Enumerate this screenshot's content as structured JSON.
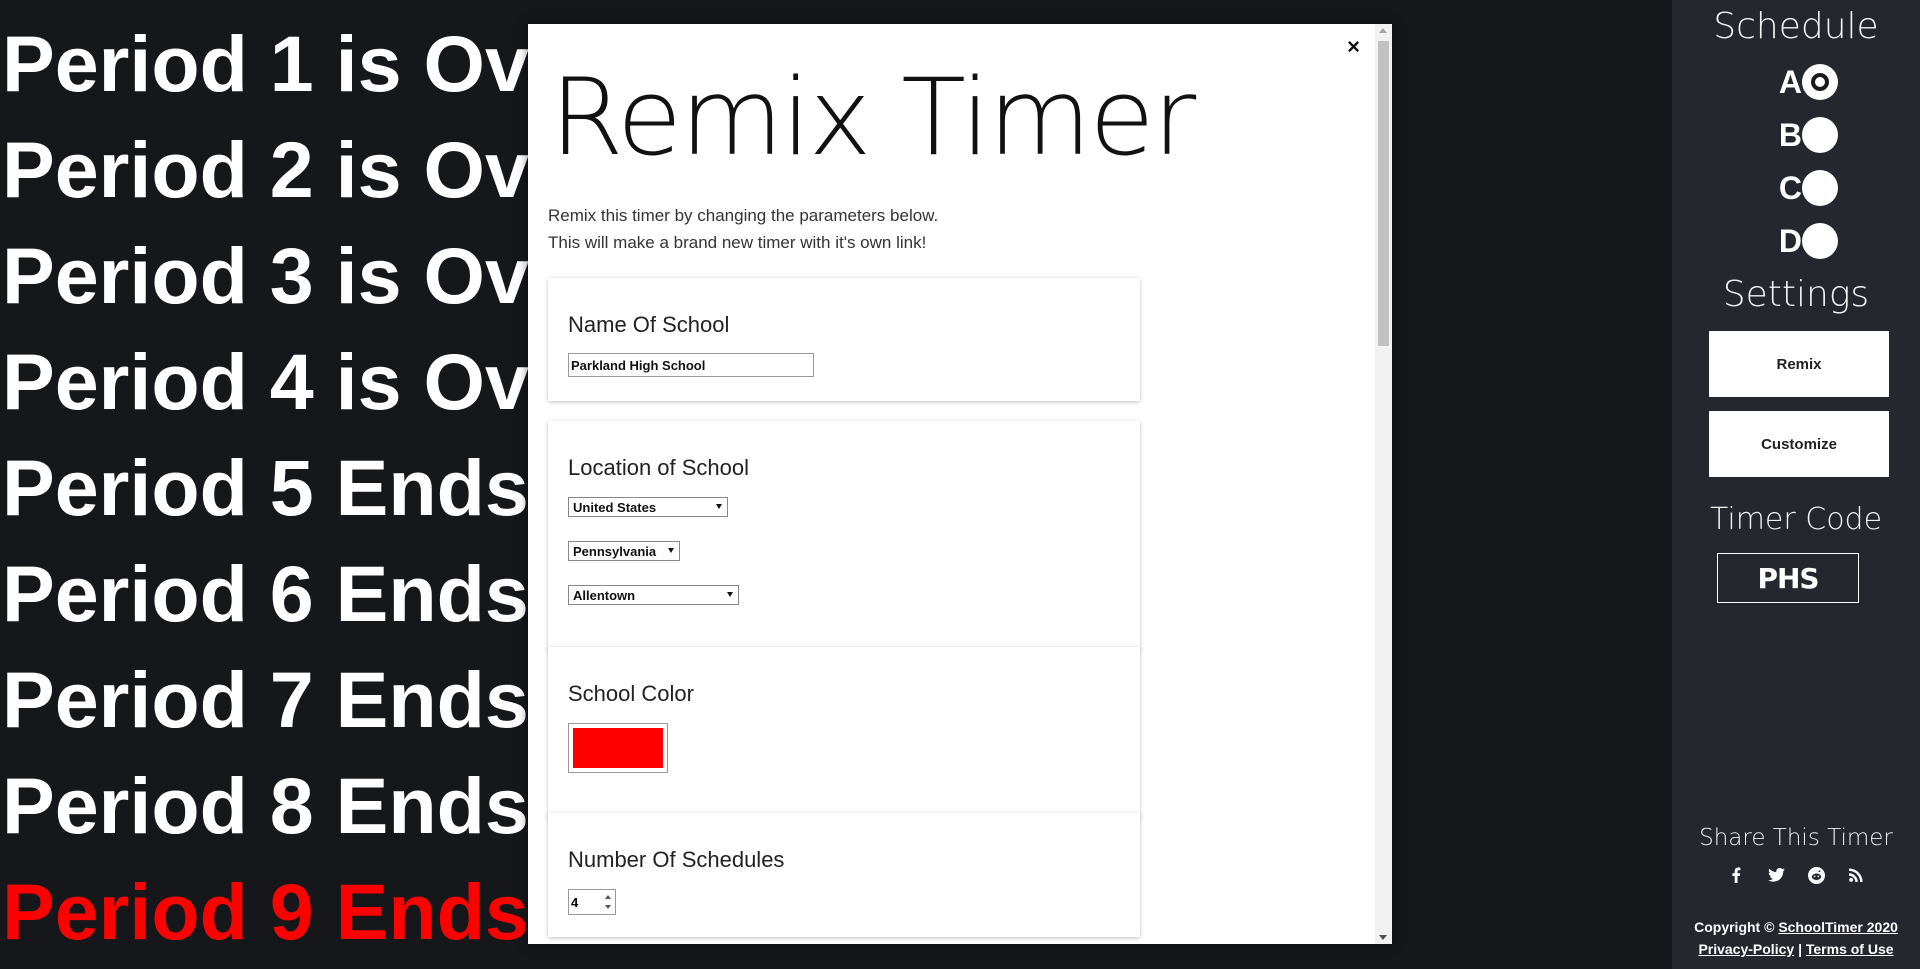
{
  "periods": [
    {
      "label": "Period 1 is Ov",
      "active": false
    },
    {
      "label": "Period 2 is Ov",
      "active": false
    },
    {
      "label": "Period 3 is Ov",
      "active": false
    },
    {
      "label": "Period 4 is Ov",
      "active": false
    },
    {
      "label": "Period 5 Ends",
      "active": false
    },
    {
      "label": "Period 6 Ends",
      "active": false
    },
    {
      "label": "Period 7 Ends",
      "active": false
    },
    {
      "label": "Period 8 Ends",
      "active": false
    },
    {
      "label": "Period 9 Ends",
      "active": true
    }
  ],
  "colors": {
    "background": "#16171b",
    "sidebar": "#25272e",
    "active_period": "#ff0000",
    "school_color": "#ff0000"
  },
  "sidebar": {
    "schedule_heading": "Schedule",
    "schedules": [
      {
        "letter": "A",
        "selected": true
      },
      {
        "letter": "B",
        "selected": false
      },
      {
        "letter": "C",
        "selected": false
      },
      {
        "letter": "D",
        "selected": false
      }
    ],
    "settings_heading": "Settings",
    "remix_label": "Remix",
    "customize_label": "Customize",
    "timer_code_heading": "Timer Code",
    "timer_code": "PHS",
    "share_heading": "Share This Timer",
    "share_icons": [
      "facebook-icon",
      "twitter-icon",
      "reddit-icon",
      "rss-icon"
    ],
    "copyright_prefix": "Copyright ©",
    "copyright_link": "SchoolTimer 2020",
    "privacy_link": "Privacy-Policy",
    "separator": "|",
    "terms_link": "Terms of Use"
  },
  "modal": {
    "close_label": "×",
    "title": "Remix Timer",
    "intro_line1": "Remix this timer by changing the parameters below.",
    "intro_line2": "This will make a brand new timer with it's own link!",
    "name_label": "Name Of School",
    "name_value": "Parkland High School",
    "location_label": "Location of School",
    "country_value": "United States",
    "state_value": "Pennsylvania",
    "city_value": "Allentown",
    "color_label": "School Color",
    "schedules_label": "Number Of Schedules",
    "schedules_value": "4"
  }
}
